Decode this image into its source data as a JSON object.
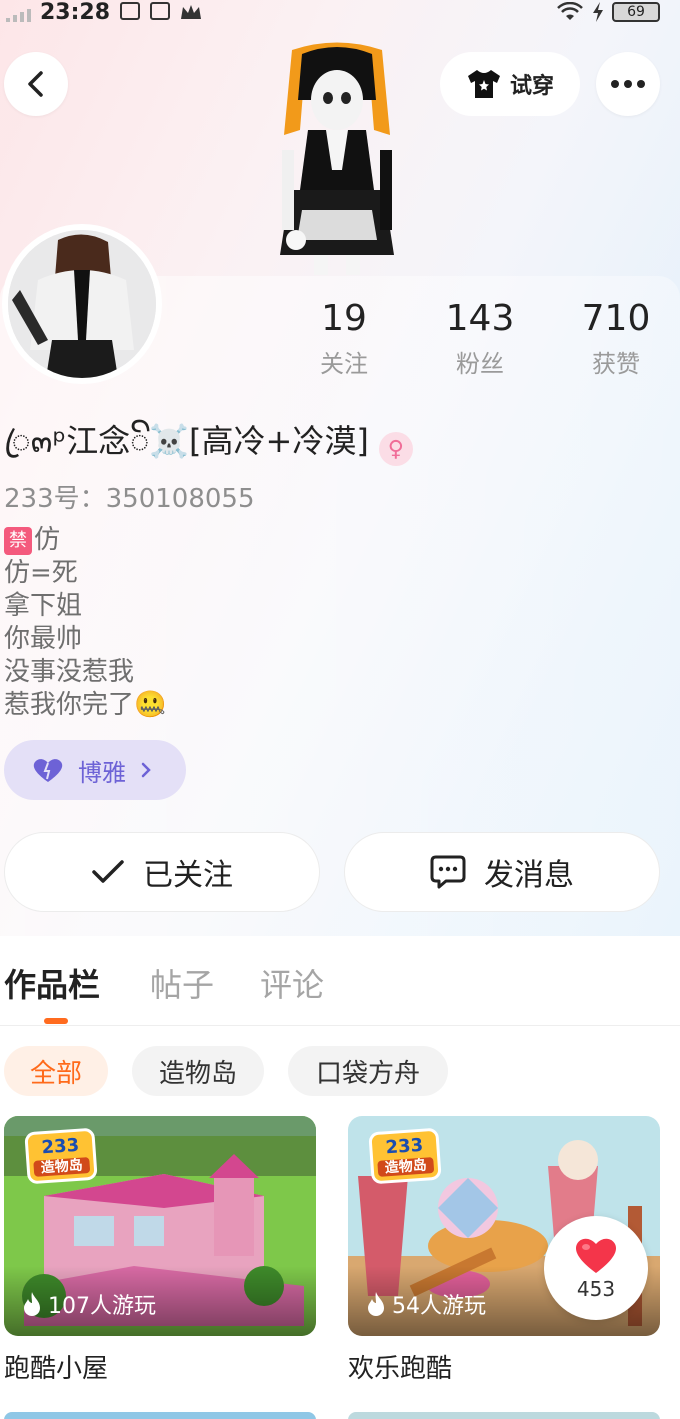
{
  "status_bar": {
    "time": "23:28",
    "battery": "69"
  },
  "header": {
    "tryon_label": "试穿"
  },
  "profile": {
    "nickname": "ꦿ๓ᵖ江念ꦼ☠️[高冷+冷漠]",
    "gender_symbol": "♀",
    "uid": "233号：350108055",
    "bio": [
      "仿",
      "仿=死",
      "拿下姐",
      "你最帅",
      "没事没惹我",
      "惹我你完了🤐"
    ],
    "bio_ban_badge": "禁",
    "stats": [
      {
        "value": "19",
        "label": "关注"
      },
      {
        "value": "143",
        "label": "粉丝"
      },
      {
        "value": "710",
        "label": "获赞"
      }
    ],
    "tag": "博雅"
  },
  "actions": {
    "follow_label": "已关注",
    "message_label": "发消息"
  },
  "tabs": [
    {
      "label": "作品栏",
      "active": true
    },
    {
      "label": "帖子",
      "active": false
    },
    {
      "label": "评论",
      "active": false
    }
  ],
  "filters": [
    {
      "label": "全部",
      "active": true
    },
    {
      "label": "造物岛",
      "active": false
    },
    {
      "label": "口袋方舟",
      "active": false
    }
  ],
  "games": [
    {
      "title": "跑酷小屋",
      "plays": "107人游玩",
      "badge_top": "233",
      "badge_bottom": "造物岛"
    },
    {
      "title": "欢乐跑酷",
      "plays": "54人游玩",
      "badge_top": "233",
      "badge_bottom": "造物岛"
    }
  ],
  "like_float": {
    "count": "453",
    "icon": "heart-icon"
  },
  "colors": {
    "accent": "#ff6b1f",
    "tag_purple": "#6d62d6",
    "heart_red": "#f4354a"
  }
}
